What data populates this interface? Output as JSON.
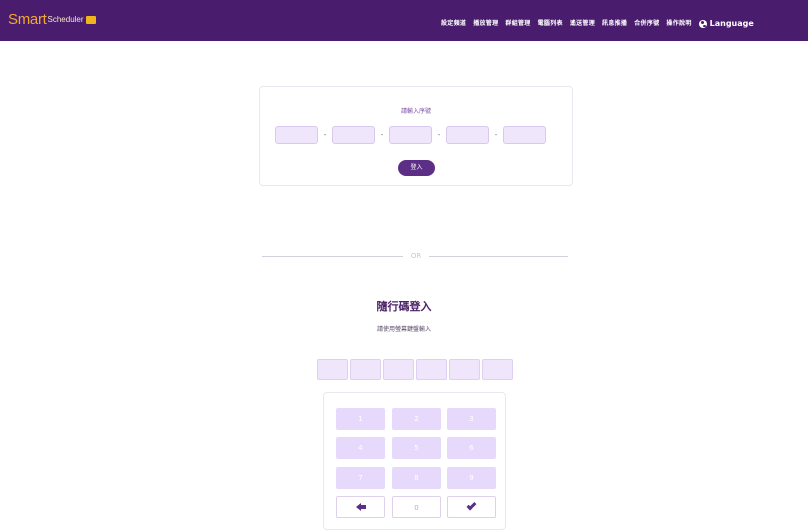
{
  "header": {
    "logo_smart": "Smart",
    "logo_scheduler": "Scheduler",
    "nav": [
      "設定頻道",
      "播放管理",
      "群組管理",
      "電腦列表",
      "遙送管理",
      "訊息推播",
      "合併序號",
      "操作說明"
    ],
    "language_label": "Language",
    "brand_color": "#4a1c6e",
    "accent_color": "#f2a92c"
  },
  "serial": {
    "title": "請輸入序號",
    "fields": [
      "",
      "",
      "",
      "",
      ""
    ],
    "separator": "-",
    "login_button": "登入"
  },
  "divider": {
    "label": "OR"
  },
  "random_code": {
    "title": "隨行碼登入",
    "subtitle": "請使用螢幕鍵盤輸入",
    "digits": [
      "",
      "",
      "",
      "",
      "",
      ""
    ]
  },
  "keypad": {
    "keys": [
      "1",
      "2",
      "3",
      "4",
      "5",
      "6",
      "7",
      "8",
      "9"
    ],
    "zero": "0",
    "back_icon": "arrow-left-icon",
    "confirm_icon": "check-icon"
  }
}
